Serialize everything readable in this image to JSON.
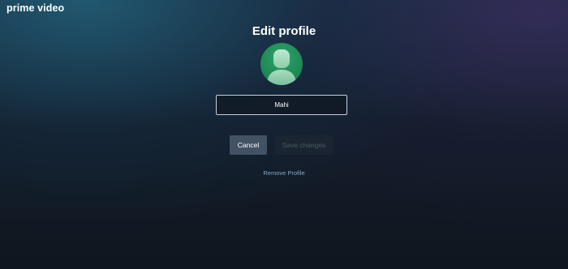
{
  "app": {
    "brand": "prime video"
  },
  "page": {
    "title": "Edit profile"
  },
  "profile": {
    "avatar_icon": "person-silhouette-icon",
    "avatar_color": "#1f8a57",
    "name_value": "Mahi"
  },
  "actions": {
    "cancel_label": "Cancel",
    "save_label": "Save changes",
    "save_enabled": false,
    "remove_label": "Remove Profile"
  },
  "colors": {
    "cancel_bg": "#425264",
    "save_bg_disabled": "#1b2532",
    "link": "#8aa7c4"
  }
}
